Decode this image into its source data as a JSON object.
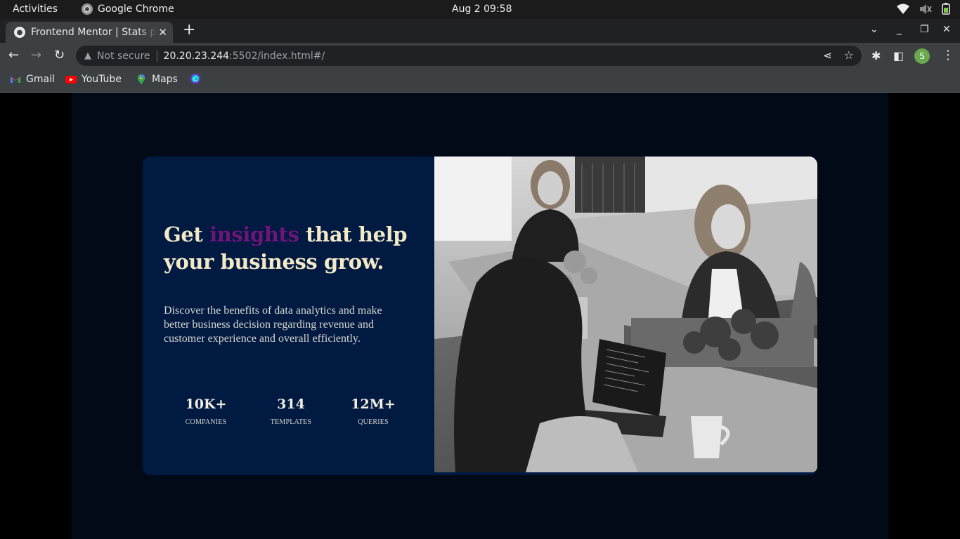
{
  "os": {
    "activities": "Activities",
    "app_name": "Google Chrome",
    "clock": "Aug 2  09:58",
    "tray_icons": [
      "wifi-icon",
      "volume-muted-icon",
      "battery-icon"
    ]
  },
  "browser": {
    "tab_title": "Frontend Mentor | Stats preview card component",
    "new_tab": "+",
    "window_controls": [
      "chevron-down-icon",
      "minimize-icon",
      "restore-icon",
      "close-icon"
    ],
    "security_label": "Not secure",
    "url_host": "20.20.23.244",
    "url_path": ":5502/index.html#/",
    "profile_initial": "S",
    "bookmarks": [
      {
        "label": "Gmail",
        "icon": "gmail-icon"
      },
      {
        "label": "YouTube",
        "icon": "youtube-icon"
      },
      {
        "label": "Maps",
        "icon": "maps-icon"
      },
      {
        "label": "",
        "icon": "canva-icon"
      }
    ]
  },
  "card": {
    "headline_pre": "Get ",
    "headline_highlight": "insights",
    "headline_post": " that help your business grow.",
    "accent_color": "#6f1478",
    "description": "Discover the benefits of data analytics and make better business decision regarding revenue and customer experience and overall efficiently.",
    "stats": [
      {
        "value": "10K+",
        "label": "COMPANIES"
      },
      {
        "value": "314",
        "label": "TEMPLATES"
      },
      {
        "value": "12M+",
        "label": "QUERIES"
      }
    ],
    "image_description": "black and white photo of women working at laptops around an office table"
  }
}
